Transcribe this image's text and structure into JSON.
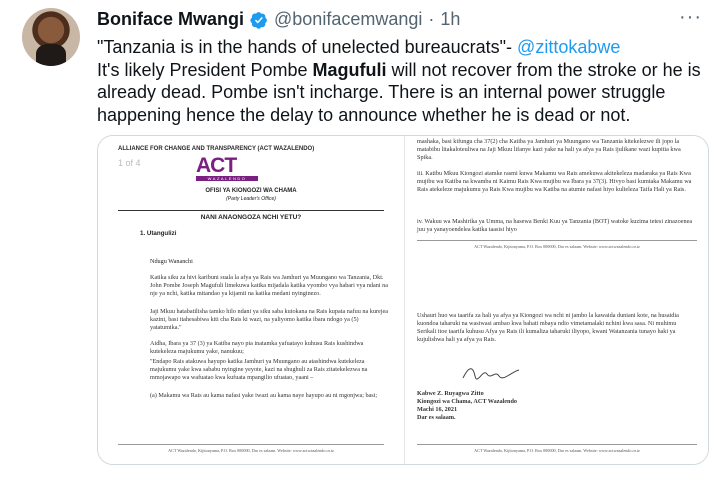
{
  "tweet": {
    "author_name": "Boniface Mwangi",
    "handle": "@bonifacemwangi",
    "separator": "·",
    "time": "1h",
    "more_label": "···",
    "quote": "\"Tanzania is in the hands of unelected bureaucrats\"- ",
    "quote_mention": "@zittokabwe",
    "line2_pre": "It's likely President Pombe ",
    "line2_bold": "Magufuli",
    "line2_post": " will not recover from the stroke or he is already dead. Pombe isn't incharge. There is an internal power struggle happening hence the delay to announce whether he is dead or not."
  },
  "document": {
    "party_header": "ALLIANCE FOR CHANGE AND TRANSPARENCY (ACT WAZALENDO)",
    "page_indicator": "1 of 4",
    "logo_text": "ACT",
    "logo_subtext": "WAZALENDO",
    "office": "OFISI YA KIONGOZI WA CHAMA",
    "office_en": "(Party Leader's Office)",
    "title": "NANI ANAONGOZA NCHI YETU?",
    "section": "1.  Utangulizi",
    "greeting": "Ndugu Wananchi",
    "para1": "Katika siku za hivi karibuni suala la afya ya Rais wa Jamhuri ya Muungano wa Tanzania, Dkt. John Pombe Joseph Magufuli limekuwa katika mijadala katika vyombo vya habari vya ndani na nje ya nchi, katika mitandao ya kijamii na katika medani nyinginezo.",
    "para2": "Jaji Mkuu hatabatilisha tamko hilo ndani ya siku saba kutokana na Rais kupata nafuu na kurejea kazini, basi itahesabiwa kiti cha Rais ki wazi, na yaliyomo katika ibara ndogo ya (5) yatatumika.\"",
    "para3": "Aidha, Ibara ya 37 (3) ya Katiba nayo pia inatamka yafuatayo kuhusu Rais kushindwa kutekeleza majukumu yake, nanukuu;",
    "para4": "\"Endapo Rais atakuwa hayupo katika Jamhuri ya Muungano au atashindwa kutekeleza majukumu yake kwa sababu nyingine yeyote, kazi na shughuli za Rais zitatekelezwa na mmojawapo wa wafuatao kwa kufuata mpangilio ufuatao, yaani –",
    "para5": "(a) Makamu wa Rais au kama nafasi yake iwazi au kama naye hayupo au ni mgonjwa; basi;",
    "footer": "ACT Wazalendo, Kijitonyama, P.O. Box 000000, Dar es salaam. Website: www.actwazalendo.or.tz",
    "r_para1": "mashaka, basi kifungu cha 37(2) cha Katiba ya Jamhuri ya Muungano wa Tanzania kitekelezwe ili jopo la matabibu litakaloteuliwa na Jaji Mkuu lifanye kazi yake na hali ya afya ya Rais ijulikane wazi kupitia kwa Spika.",
    "r_para2": "iii.  Katibu Mkuu Kiongozi atamke rasmi kuwa Makamu wa Rais amekuwa akitekeleza madaraka ya Rais Kwa mujibu wa Katiba na kwamba ni Kaimu Rais Kwa mujibu wa Ibara ya 37(3). Hivyo basi kumtaka Makamu wa Rais atekeleze majukumu ya Rais Kwa mujibu wa Katiba na atumie nafasi hiyo kulieleza Taifa Hali ya Rais.",
    "r_para3": "iv.  Wakuu wa Mashirika ya Umma, na hasewa Benki Kuu ya Tanzania (BOT) watoke kuzima tetesi zinazoenea juu ya yanayoendelea katika taasisi hiyo",
    "r_para4": "Ushauri huo wa taarifa za hali ya afya ya Kiongozi wa nchi ni jambo la kawaida duniani kote, na husaidia kuondoa taharuki na wasiwasi ambao kwa bahati mbaya ndio vimetamalaki nchini kwa sasa. Ni muhimu Serikali itoe taarifa kuhusu Afya ya Rais ili kumaliza taharuki iliyopo, kwani Watanzania tunayo haki ya kujulishwa hali ya afya ya Rais.",
    "signatory": "Kabwe Z. Ruyagwa Zitto",
    "signatory_title": "Kiongozi wa Chama, ACT Wazalendo",
    "date": "Machi 16, 2021",
    "place": "Dar es salaam."
  },
  "colors": {
    "mention": "#1d9bf0",
    "verified": "#1d9bf0",
    "logo": "#7b1f82"
  },
  "icons": [
    "verified-badge-icon",
    "more-options-icon"
  ]
}
